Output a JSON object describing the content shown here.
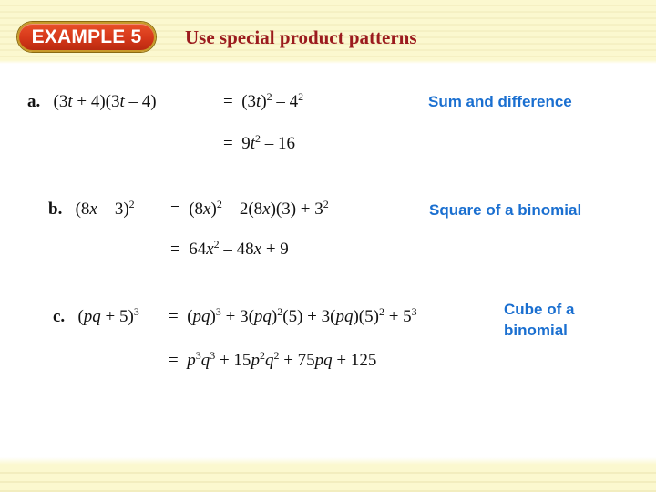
{
  "header": {
    "badge": "EXAMPLE 5",
    "title": "Use special product patterns"
  },
  "colors": {
    "badge_bg": "#d6381a",
    "title": "#9b1b1e",
    "note": "#1a6fd0",
    "band": "#fbf8cf"
  },
  "examples": [
    {
      "label": "a.",
      "lhs": "(3t + 4)(3t – 4)",
      "step1": "= (3t)² – 4²",
      "step2": "= 9t² – 16",
      "note": "Sum and difference"
    },
    {
      "label": "b.",
      "lhs": "(8x – 3)²",
      "step1": "= (8x)² – 2(8x)(3) + 3²",
      "step2": "= 64x² – 48x + 9",
      "note": "Square of a binomial"
    },
    {
      "label": "c.",
      "lhs": "(pq + 5)³",
      "step1": "= (pq)³ + 3(pq)²(5) + 3(pq)(5)² + 5³",
      "step2": "= p³q³ + 15p²q² + 75pq + 125",
      "note_line1": "Cube of a",
      "note_line2": "binomial"
    }
  ]
}
